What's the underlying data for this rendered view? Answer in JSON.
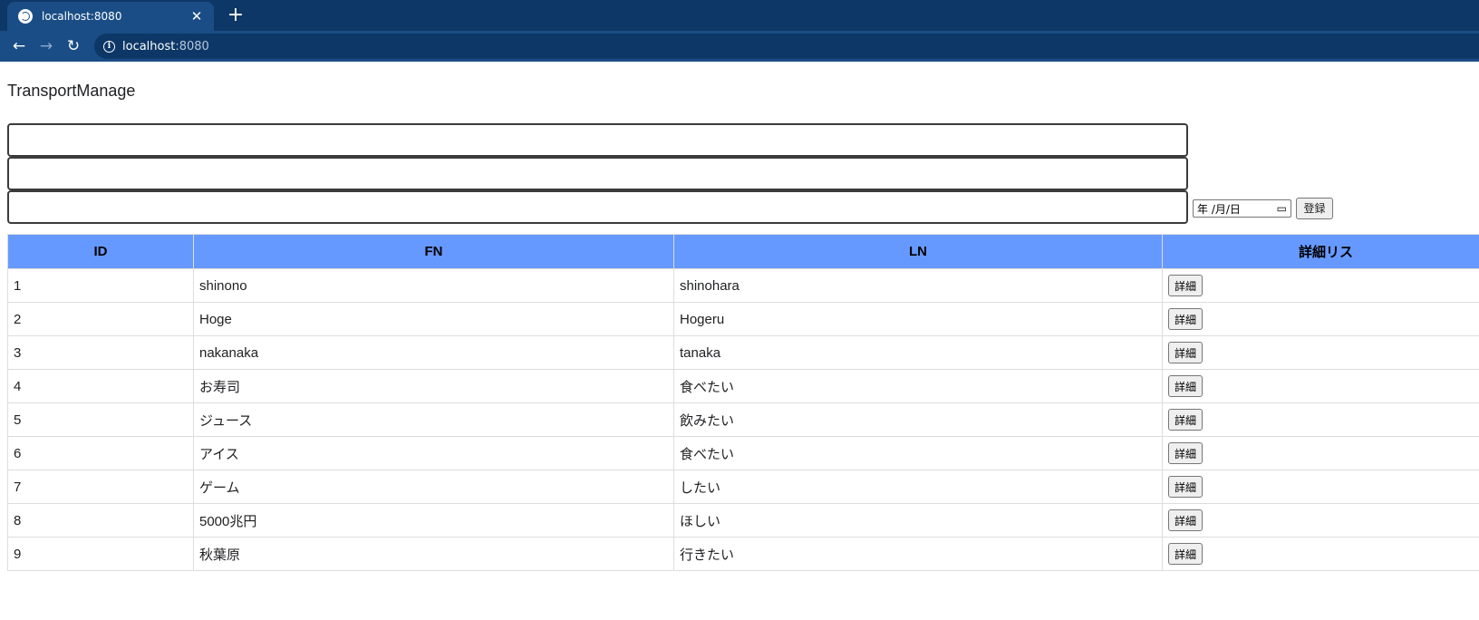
{
  "browser": {
    "tab_title": "localhost:8080",
    "tab_close": "✕",
    "new_tab": "+",
    "back": "←",
    "forward": "→",
    "reload": "↻",
    "url_host": "localhost",
    "url_port": ":8080"
  },
  "app": {
    "title": "TransportManage",
    "date_placeholder": "年 /月/日",
    "submit_label": "登録"
  },
  "table": {
    "headers": [
      "ID",
      "FN",
      "LN",
      "詳細リス"
    ],
    "detail_label": "詳細",
    "rows": [
      {
        "id": "1",
        "fn": "shinono",
        "ln": "shinohara"
      },
      {
        "id": "2",
        "fn": "Hoge",
        "ln": "Hogeru"
      },
      {
        "id": "3",
        "fn": "nakanaka",
        "ln": "tanaka"
      },
      {
        "id": "4",
        "fn": "お寿司",
        "ln": "食べたい"
      },
      {
        "id": "5",
        "fn": "ジュース",
        "ln": "飲みたい"
      },
      {
        "id": "6",
        "fn": "アイス",
        "ln": "食べたい"
      },
      {
        "id": "7",
        "fn": "ゲーム",
        "ln": "したい"
      },
      {
        "id": "8",
        "fn": "5000兆円",
        "ln": "ほしい"
      },
      {
        "id": "9",
        "fn": "秋葉原",
        "ln": "行きたい"
      }
    ]
  }
}
